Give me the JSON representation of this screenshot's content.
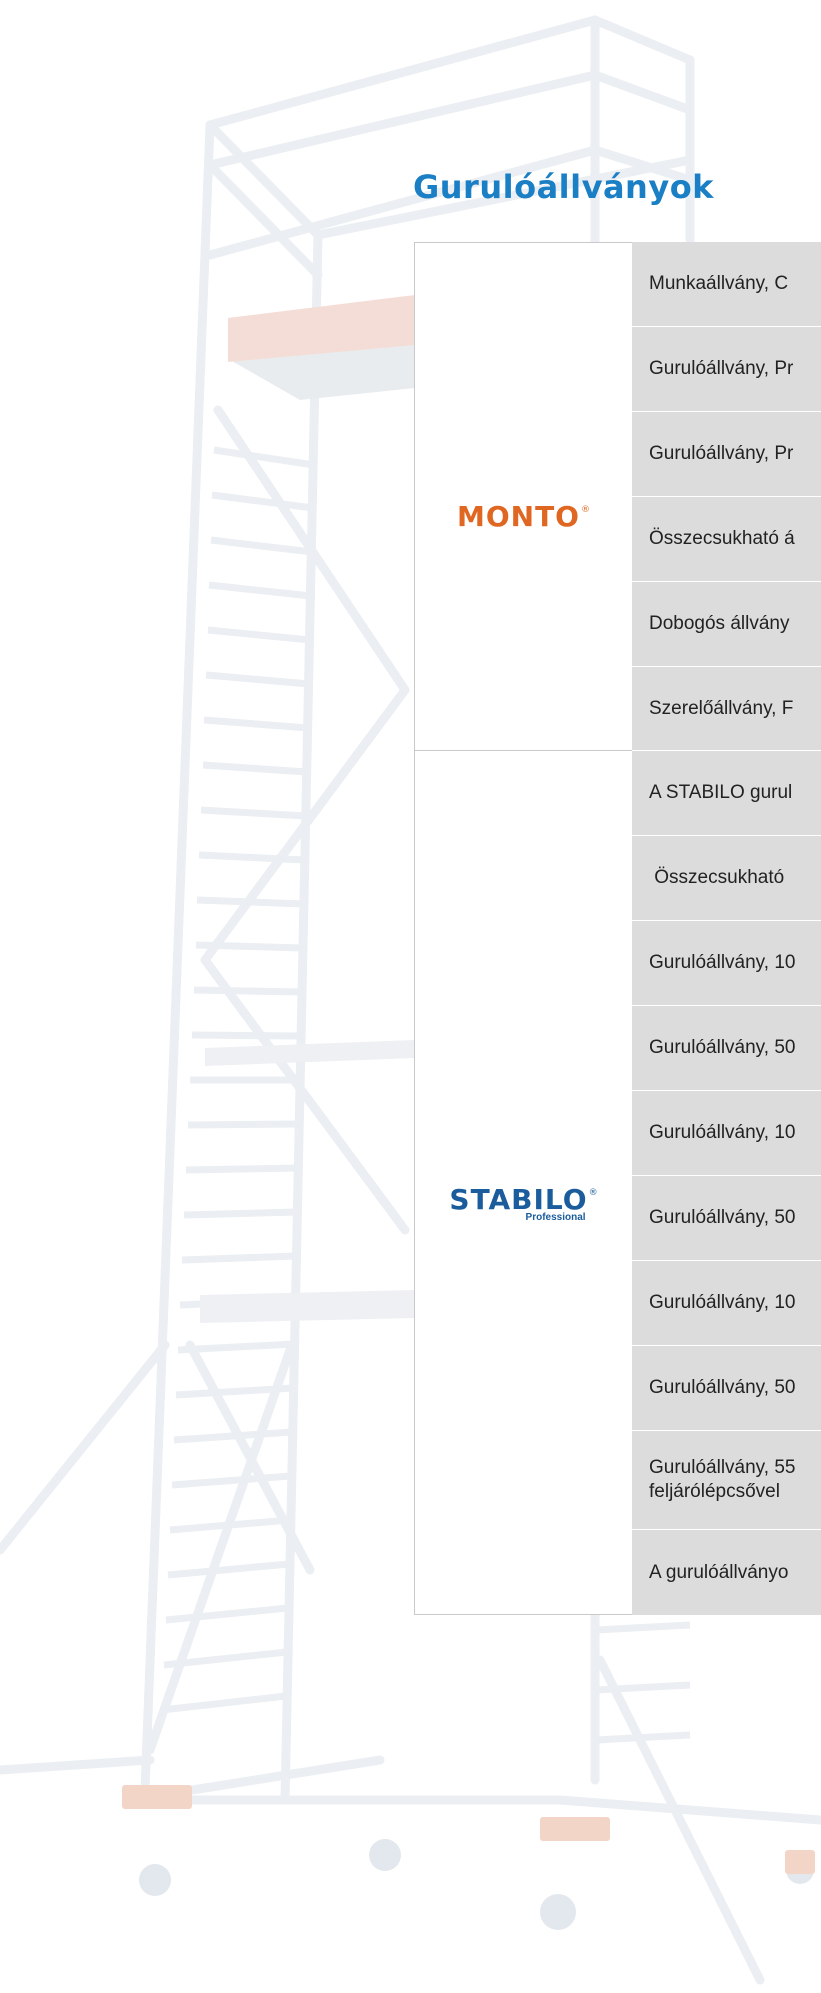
{
  "title": "Gurulóállványok",
  "brands": {
    "monto": {
      "name": "MONTO",
      "reg": "®"
    },
    "stabilo": {
      "name": "STABILO",
      "reg": "®",
      "sub": "Professional"
    }
  },
  "items": [
    "Munkaállvány, C",
    "Gurulóállvány, Pr",
    "Gurulóállvány, Pr",
    "Összecsukható á",
    "Dobogós állvány",
    "Szerelőállvány, F",
    "A STABILO gurul",
    " Összecsukható",
    "Gurulóállvány, 10",
    "Gurulóállvány, 50",
    "Gurulóállvány, 10",
    "Gurulóállvány, 50",
    "Gurulóállvány, 10",
    "Gurulóállvány, 50",
    "Gurulóállvány, 55\nfeljárólépcsővel",
    "A gurulóállványo"
  ],
  "colors": {
    "title": "#1a7fc4",
    "monto": "#e06722",
    "stabilo": "#1a5c9c",
    "row_bg": "#dcdcdd"
  }
}
